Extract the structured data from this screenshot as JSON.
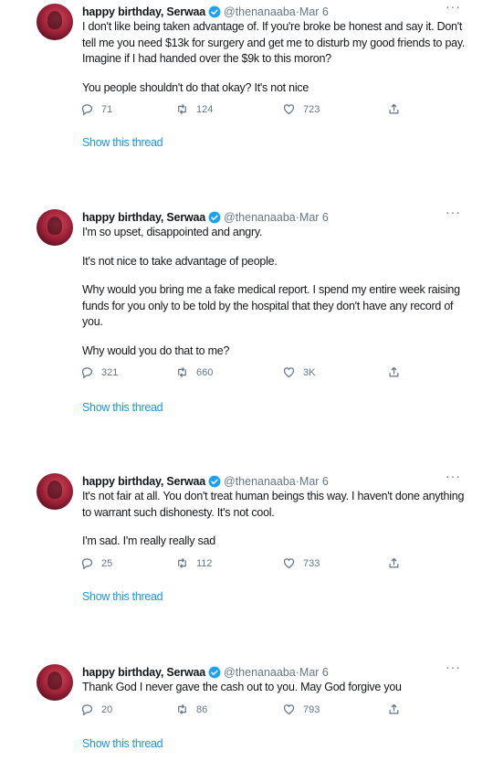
{
  "tweets": [
    {
      "author_name": "happy birthday, Serwaa",
      "handle": "@thenanaaba",
      "date": "Mar 6",
      "more": "···",
      "paragraphs": [
        "I don't like being taken advantage of. If you're broke be honest and say it. Don't tell me you need $13k for surgery and get me to disturb my good friends to pay. Imagine if I had handed over the $9k to this moron?",
        "You people shouldn't do that okay? It's not nice"
      ],
      "replies": "71",
      "retweets": "124",
      "likes": "723",
      "thread_link": "Show this thread"
    },
    {
      "author_name": "happy birthday, Serwaa",
      "handle": "@thenanaaba",
      "date": "Mar 6",
      "more": "···",
      "paragraphs": [
        "I'm so upset, disappointed and angry.",
        "It's not nice to take advantage of people.",
        "Why would you bring me a fake medical report. I spend my entire week raising funds for you only to be told by the hospital that they don't have any record of you.",
        "Why would you do that to me?"
      ],
      "replies": "321",
      "retweets": "660",
      "likes": "3K",
      "thread_link": "Show this thread"
    },
    {
      "author_name": "happy birthday, Serwaa",
      "handle": "@thenanaaba",
      "date": "Mar 6",
      "more": "···",
      "paragraphs": [
        "It's not fair at all. You don't treat human beings this way. I haven't done anything to warrant such dishonesty. It's not cool.",
        "I'm sad. I'm really really sad"
      ],
      "replies": "25",
      "retweets": "112",
      "likes": "733",
      "thread_link": "Show this thread"
    },
    {
      "author_name": "happy birthday, Serwaa",
      "handle": "@thenanaaba",
      "date": "Mar 6",
      "more": "···",
      "paragraphs": [
        "Thank God I never gave the cash out to you. May God forgive you"
      ],
      "replies": "20",
      "retweets": "86",
      "likes": "793",
      "thread_link": "Show this thread"
    }
  ],
  "separator": " · ",
  "icons": {
    "verified": "verified-badge-icon",
    "reply": "reply-icon",
    "retweet": "retweet-icon",
    "like": "heart-icon",
    "share": "share-icon",
    "more": "more-icon"
  },
  "colors": {
    "link": "#1b95e0",
    "verified": "#1da1f2",
    "muted": "#657786",
    "text": "#14171a"
  }
}
